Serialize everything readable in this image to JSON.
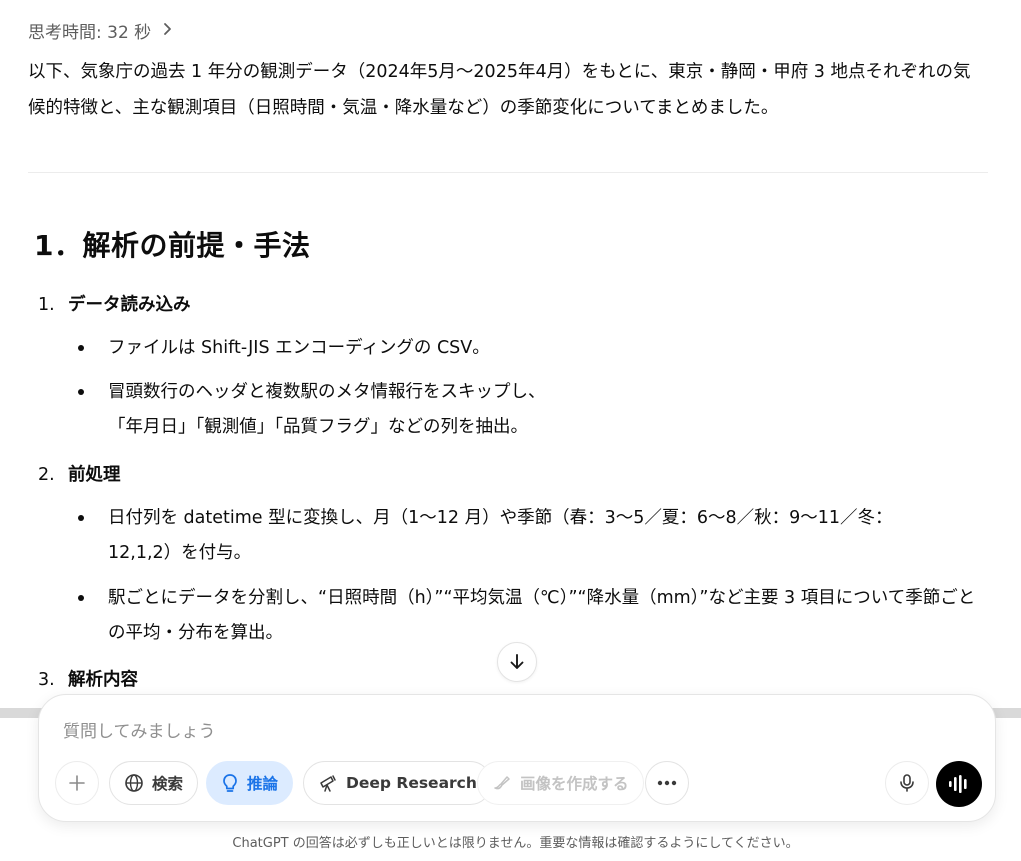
{
  "thinking": {
    "label": "思考時間: 32 秒"
  },
  "intro": {
    "line1": "以下、気象庁の過去 1 年分の観測データ（2024年5月〜2025年4月）をもとに、東京・静岡・甲府 3 地点それぞれの気",
    "line2": "候的特徴と、主な観測項目（日照時間・気温・降水量など）の季節変化についてまとめました。"
  },
  "section": {
    "title": "1．解析の前提・手法"
  },
  "items": [
    {
      "num": "1.",
      "title": "データ読み込み",
      "bullets": [
        {
          "line1": "ファイルは Shift-JIS エンコーディングの CSV。",
          "line2": ""
        },
        {
          "line1": "冒頭数行のヘッダと複数駅のメタ情報行をスキップし、",
          "line2": "「年月日」「観測値」「品質フラグ」などの列を抽出。"
        }
      ]
    },
    {
      "num": "2.",
      "title": "前処理",
      "bullets": [
        {
          "line1": "日付列を datetime 型に変換し、月（1〜12 月）や季節（春：3〜5／夏：6〜8／秋：9〜11／冬：",
          "line2": "12,1,2）を付与。"
        },
        {
          "line1": "駅ごとにデータを分割し、“日照時間（h）”“平均気温（℃）”“降水量（mm）”など主要 3 項目について季節ごと",
          "line2": "の平均・分布を算出。"
        }
      ]
    },
    {
      "num": "3.",
      "title": "解析内容"
    }
  ],
  "composer": {
    "placeholder": "質問してみましょう",
    "search_label": "検索",
    "reason_label": "推論",
    "deep_research_label": "Deep Research",
    "image_label": "画像を作成する"
  },
  "footer": {
    "note": "ChatGPT の回答は必ずしも正しいとは限りません。重要な情報は確認するようにしてください。"
  },
  "colors": {
    "accent": "#1a73e8",
    "accent_bg": "#dcebff"
  }
}
